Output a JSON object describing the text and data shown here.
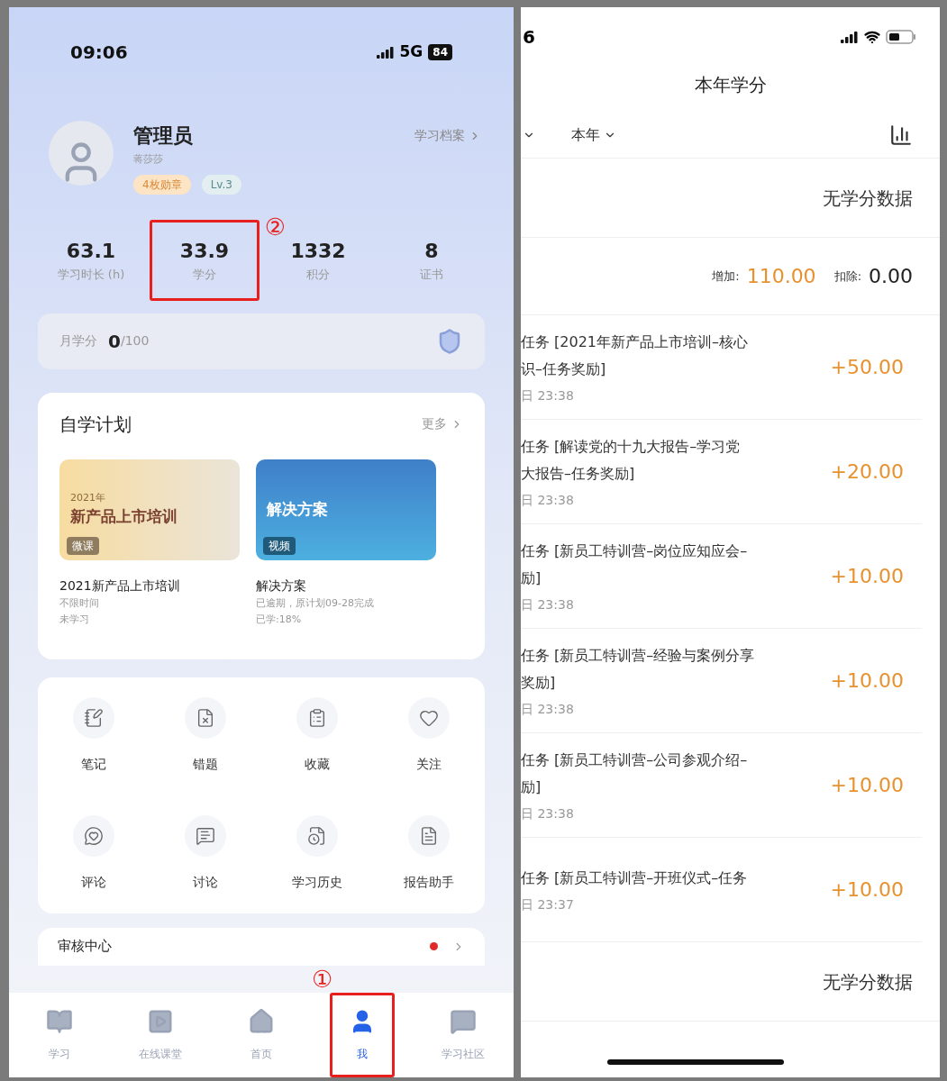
{
  "left_screen": {
    "status_bar": {
      "time": "09:06",
      "network": "5G",
      "battery": "84"
    },
    "profile": {
      "name": "管理员",
      "subtitle": "蒋莎莎",
      "badges": [
        {
          "label": "4枚勋章",
          "kind": "medal"
        },
        {
          "label": "Lv.3",
          "kind": "level"
        }
      ],
      "archive_link": "学习档案"
    },
    "stats": [
      {
        "value": "63.1",
        "label": "学习时长 (h)",
        "highlighted": false
      },
      {
        "value": "33.9",
        "label": "学分",
        "highlighted": true,
        "annotation": "②"
      },
      {
        "value": "1332",
        "label": "积分",
        "highlighted": false
      },
      {
        "value": "8",
        "label": "证书",
        "highlighted": false
      }
    ],
    "monthly_credit": {
      "label": "月学分",
      "value": "0",
      "total": "/100"
    },
    "self_study_plan": {
      "title": "自学计划",
      "more": "更多",
      "courses": [
        {
          "kind": "warm",
          "banner_year": "2021年",
          "banner_title": "新产品上市培训",
          "tag": "微课",
          "title": "2021新产品上市培训",
          "lines": [
            "不限时间",
            "未学习"
          ]
        },
        {
          "kind": "cool",
          "banner_title": "解决方案",
          "tag": "视频",
          "title": "解决方案",
          "lines": [
            "已逾期，原计划09-28完成",
            "已学:18%"
          ]
        }
      ]
    },
    "shortcuts": [
      {
        "label": "笔记",
        "kind": "note"
      },
      {
        "label": "错题",
        "kind": "wrong"
      },
      {
        "label": "收藏",
        "kind": "favorite"
      },
      {
        "label": "关注",
        "kind": "follow"
      },
      {
        "label": "评论",
        "kind": "comment"
      },
      {
        "label": "讨论",
        "kind": "discuss"
      },
      {
        "label": "学习历史",
        "kind": "history"
      },
      {
        "label": "报告助手",
        "kind": "report"
      }
    ],
    "review_center": {
      "title": "审核中心",
      "unread": true
    },
    "tabs": [
      {
        "label": "学习",
        "kind": "book",
        "selected": false,
        "highlighted": false
      },
      {
        "label": "在线课堂",
        "kind": "video",
        "selected": false,
        "highlighted": false
      },
      {
        "label": "首页",
        "kind": "home",
        "selected": false,
        "highlighted": false
      },
      {
        "label": "我",
        "kind": "person",
        "selected": true,
        "highlighted": true,
        "annotation": "①"
      },
      {
        "label": "学习社区",
        "kind": "chat",
        "selected": false,
        "highlighted": false
      }
    ]
  },
  "right_screen": {
    "status_bar": {
      "time": "6"
    },
    "title": "本年学分",
    "filters": [
      {
        "label": "本年"
      }
    ],
    "sections": [
      {
        "kind": "empty",
        "text": "无学分数据"
      },
      {
        "kind": "summary",
        "add_label": "增加:",
        "add_value": "110.00",
        "deduct_label": "扣除:",
        "deduct_value": "0.00"
      }
    ],
    "records": [
      {
        "lines": [
          "任务 [2021年新产品上市培训–核心",
          "识–任务奖励]"
        ],
        "time": "日 23:38",
        "amount": "+50.00"
      },
      {
        "lines": [
          "任务 [解读党的十九大报告–学习党",
          "大报告–任务奖励]"
        ],
        "time": "日 23:38",
        "amount": "+20.00"
      },
      {
        "lines": [
          "任务 [新员工特训营–岗位应知应会–",
          "励]"
        ],
        "time": "日 23:38",
        "amount": "+10.00"
      },
      {
        "lines": [
          "任务 [新员工特训营–经验与案例分享",
          "奖励]"
        ],
        "time": "日 23:38",
        "amount": "+10.00"
      },
      {
        "lines": [
          "任务 [新员工特训营–公司参观介绍–",
          "励]"
        ],
        "time": "日 23:38",
        "amount": "+10.00"
      },
      {
        "lines": [
          "任务 [新员工特训营–开班仪式–任务"
        ],
        "time": "日 23:37",
        "amount": "+10.00"
      }
    ],
    "footer_empty": "无学分数据"
  }
}
